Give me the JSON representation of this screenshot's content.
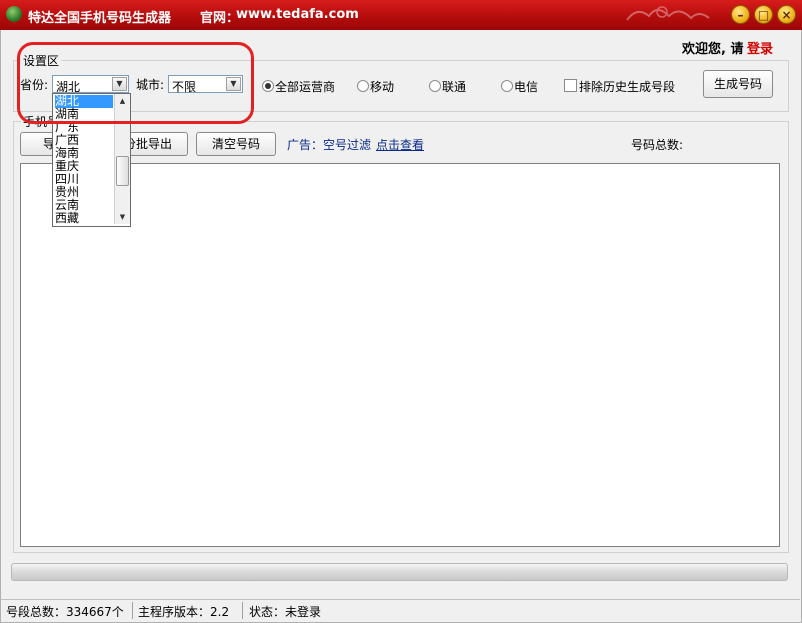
{
  "window": {
    "title": "特达全国手机号码生成器",
    "site_label": "官网：",
    "site_url": "www.tedafa.com",
    "minimize": "–",
    "maximize": "□",
    "close": "×"
  },
  "header": {
    "welcome": "欢迎您, 请",
    "login": "登录"
  },
  "settings": {
    "group_label": "设置区",
    "province_label": "省份:",
    "province_value": "湖北",
    "city_label": "城市:",
    "city_value": "不限",
    "carriers": [
      {
        "label": "全部运营商",
        "selected": true
      },
      {
        "label": "移动",
        "selected": false
      },
      {
        "label": "联通",
        "selected": false
      },
      {
        "label": "电信",
        "selected": false
      }
    ],
    "exclude_history_label": "排除历史生成号段",
    "exclude_history_checked": false,
    "generate_button": "生成号码"
  },
  "province_dropdown": {
    "items": [
      "湖北",
      "湖南",
      "广东",
      "广西",
      "海南",
      "重庆",
      "四川",
      "贵州",
      "云南",
      "西藏"
    ],
    "selected_index": 0
  },
  "phones": {
    "group_label": "手机号",
    "export_button": "导出",
    "batch_export_button": "分批导出",
    "clear_button": "清空号码",
    "ad_text": "广告：空号过滤",
    "ad_link": "点击查看",
    "total_label": "号码总数:"
  },
  "statusbar": {
    "segment_total": "号段总数：334667个",
    "version": "主程序版本：2.2",
    "status": "状态：未登录"
  },
  "colors": {
    "title_bar": "#c0100f",
    "accent_red": "#d40000",
    "highlight": "#e52020",
    "link_blue": "#0a2a8a"
  }
}
